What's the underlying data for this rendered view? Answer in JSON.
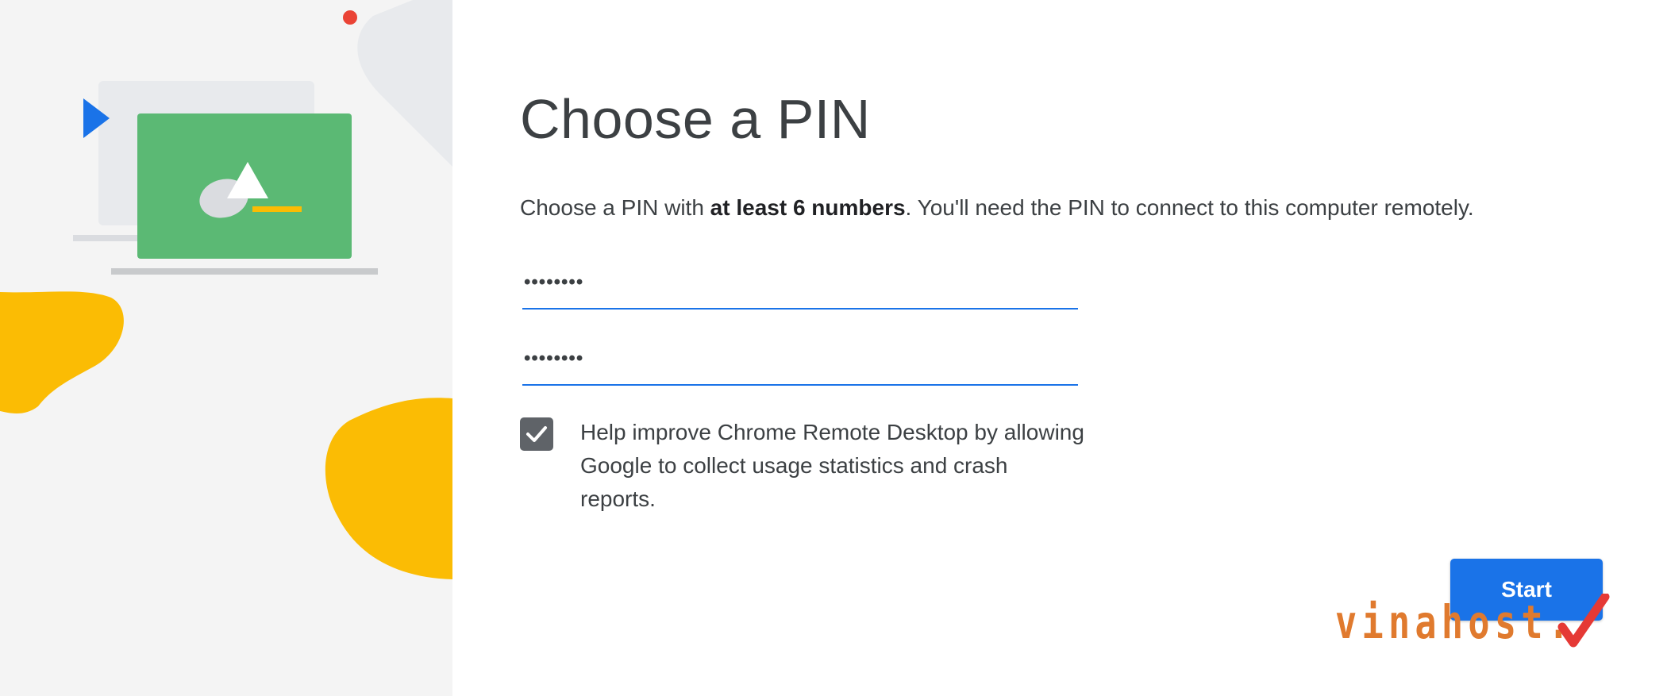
{
  "main": {
    "title": "Choose a PIN",
    "description_prefix": "Choose a PIN with ",
    "description_bold": "at least 6 numbers",
    "description_suffix": ". You'll need the PIN to connect to this computer remotely.",
    "pin_value_display": "••••••••",
    "pin_confirm_value_display": "••••••••",
    "consent_checked": true,
    "consent_label": "Help improve Chrome Remote Desktop by allowing Google to collect usage statistics and crash reports.",
    "start_label": "Start"
  },
  "watermark": {
    "text": "vinahost.",
    "icon": "checkmark-icon"
  },
  "illustration": {
    "icons": [
      "laptop-icon",
      "play-arrow-icon",
      "triangle-icon"
    ]
  },
  "colors": {
    "accent": "#1a73e8",
    "checkbox": "#5f6368",
    "illustration_green": "#5bb974",
    "illustration_yellow": "#fbbc04",
    "illustration_blue": "#1a73e8",
    "illustration_red": "#ea4335",
    "watermark_orange": "#e07a2e",
    "watermark_red": "#e53935"
  }
}
